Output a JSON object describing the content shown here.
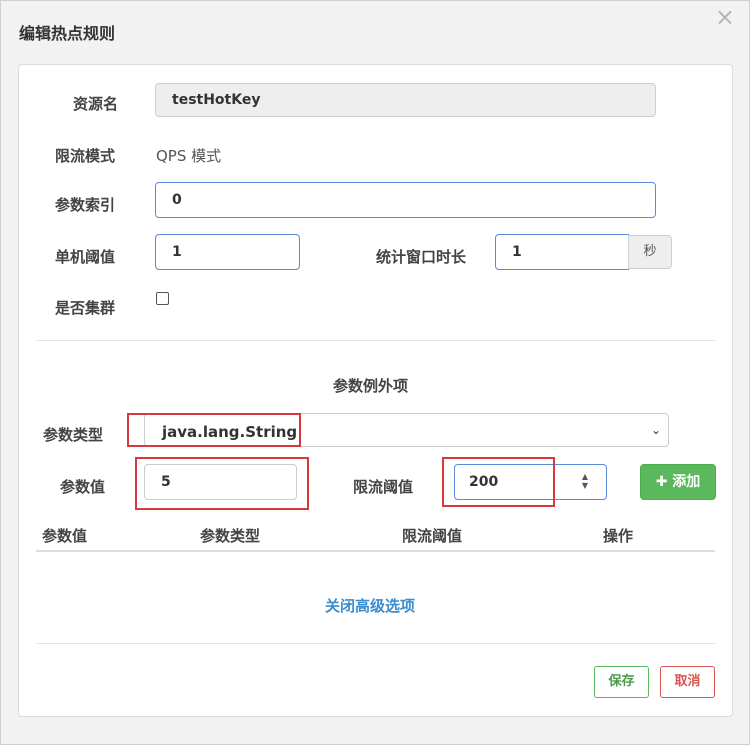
{
  "dialog": {
    "title": "编辑热点规则",
    "close": "×"
  },
  "form": {
    "resource_label": "资源名",
    "resource_value": "testHotKey",
    "mode_label": "限流模式",
    "mode_value": "QPS 模式",
    "param_index_label": "参数索引",
    "param_index_value": "0",
    "threshold_label": "单机阈值",
    "threshold_value": "1",
    "window_label": "统计窗口时长",
    "window_value": "1",
    "window_unit": "秒",
    "cluster_label": "是否集群",
    "cluster_checked": false
  },
  "exceptions": {
    "section_title": "参数例外项",
    "param_type_label": "参数类型",
    "param_type_value": "java.lang.String",
    "param_value_label": "参数值",
    "param_value": "5",
    "limit_label": "限流阈值",
    "limit_value": "200",
    "add_button": "添加",
    "table_headers": [
      "参数值",
      "参数类型",
      "限流阈值",
      "操作"
    ],
    "close_advanced": "关闭高级选项"
  },
  "footer": {
    "save": "保存",
    "cancel": "取消"
  },
  "colors": {
    "primary_border": "#5b8bd6",
    "annotation_red": "#d9363e",
    "success": "#5cb85c",
    "danger": "#d9534f",
    "link": "#3c8dcf"
  }
}
